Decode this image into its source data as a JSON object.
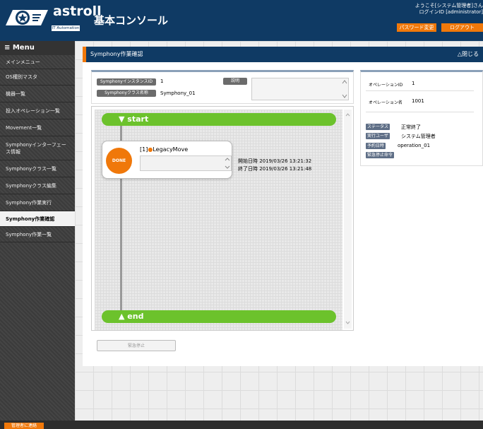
{
  "header": {
    "logo_text": "astroll",
    "logo_sub": "IT Automation",
    "console_title": "基本コンソール",
    "welcome_line1": "ようこそ[システム管理者]さん",
    "welcome_line2": "ログインID [administrator]",
    "password_button": "パスワード変更",
    "logout_button": "ログアウト"
  },
  "sidebar": {
    "menu_label": "≡ Menu",
    "items": [
      {
        "label": "メインメニュー"
      },
      {
        "label": "OS種別マスタ"
      },
      {
        "label": "機器一覧"
      },
      {
        "label": "投入オペレーション一覧"
      },
      {
        "label": "Movement一覧"
      },
      {
        "label": "Symphonyインターフェース情報"
      },
      {
        "label": "Symphonyクラス一覧"
      },
      {
        "label": "Symphonyクラス編集"
      },
      {
        "label": "Symphony作業実行"
      },
      {
        "label": "Symphony作業確認"
      },
      {
        "label": "Symphony作業一覧"
      }
    ]
  },
  "panel": {
    "title": "Symphony作業確認",
    "close_label": "△閉じる"
  },
  "info": {
    "instance_id_label": "SymphonyインスタンスID",
    "instance_id_value": "1",
    "class_name_label": "Symphonyクラス名称",
    "class_name_value": "Symphony_01",
    "description_label": "説明"
  },
  "flow": {
    "start_label": "▼ start",
    "end_label": "▲ end",
    "movement": {
      "status": "DONE",
      "index": "[1]",
      "name": "LegacyMove",
      "start_time": "開始日時 2019/03/26 13:21:32",
      "end_time": "終了日時 2019/03/26 13:21:48"
    },
    "stop_button": "緊急停止"
  },
  "operation": {
    "id_label": "オペレーションID",
    "id_value": "1",
    "name_label": "オペレーション名",
    "name_value": "1001",
    "status_label": "ステータス",
    "status_value": "正常終了",
    "user_label": "実行ユーザ",
    "user_value": "システム管理者",
    "reserve_label": "予約日時",
    "reserve_value": "operation_01",
    "stop_command": "緊急停止命令"
  },
  "footer": {
    "contact_button": "管理者に連絡"
  },
  "colors": {
    "header_bg": "#0f3a64",
    "accent_orange": "#f0780a",
    "flow_green": "#6cc22c"
  }
}
